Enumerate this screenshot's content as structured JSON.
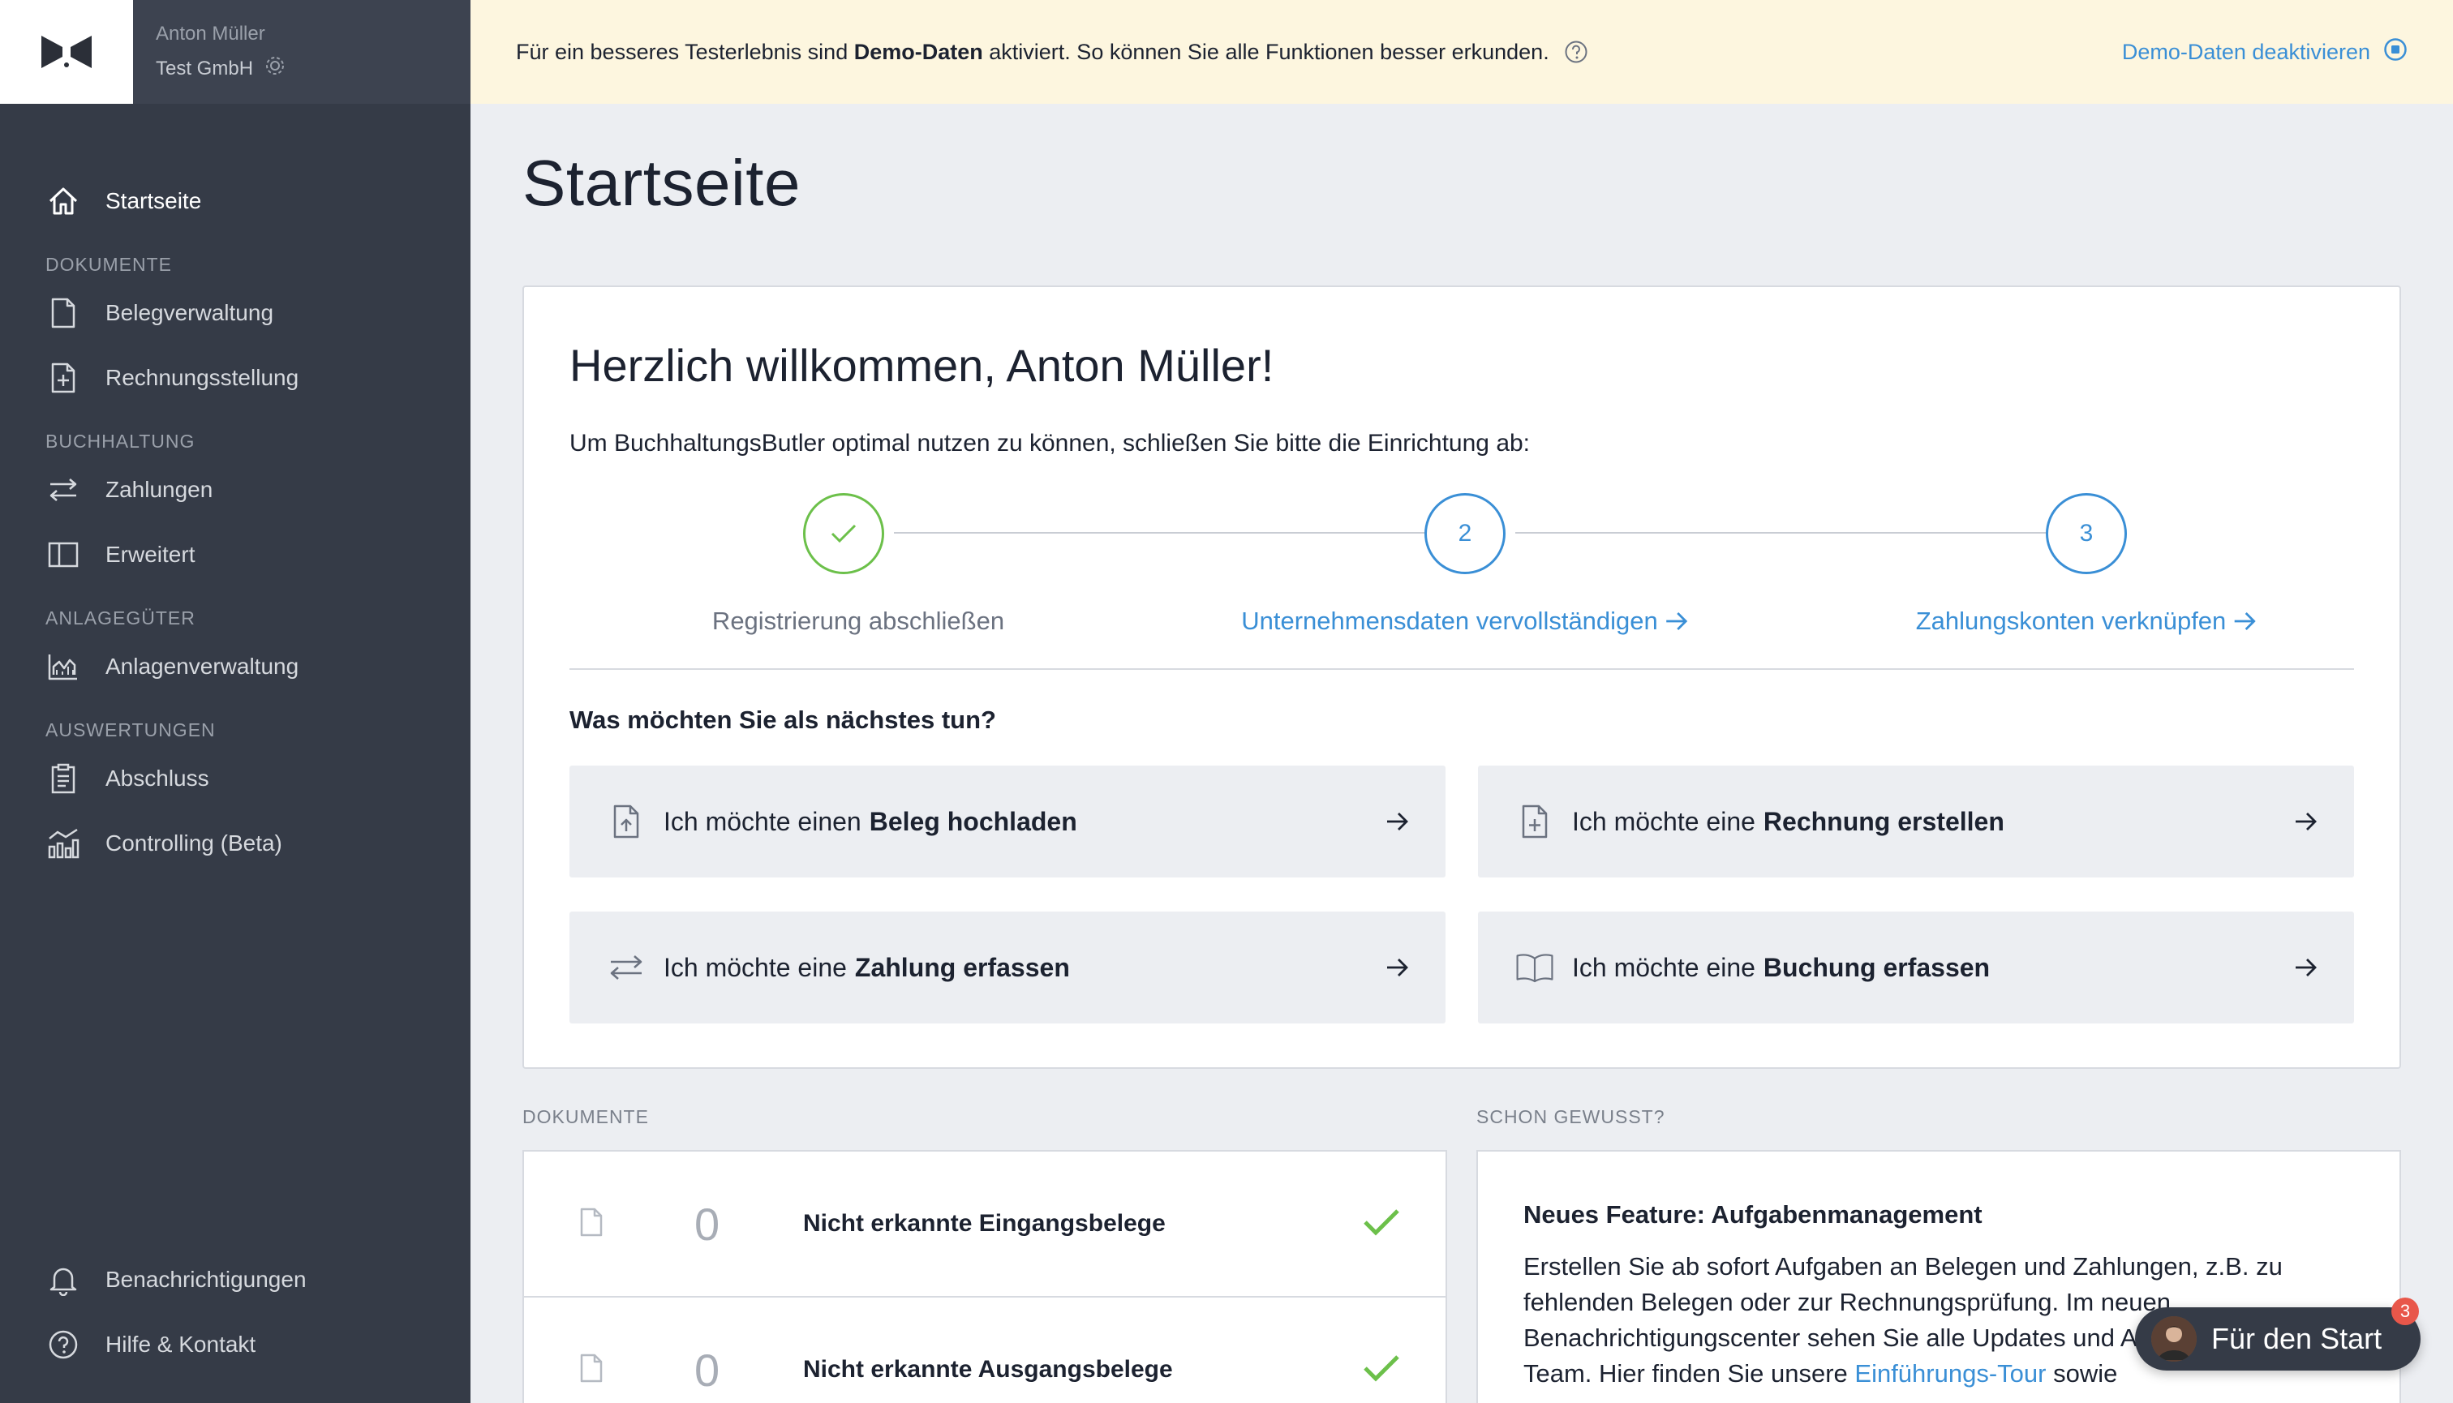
{
  "sidebar": {
    "user_name": "Anton Müller",
    "company": "Test GmbH",
    "nav": {
      "startseite": "Startseite",
      "section_dokumente": "DOKUMENTE",
      "belegverwaltung": "Belegverwaltung",
      "rechnungsstellung": "Rechnungsstellung",
      "section_buchhaltung": "BUCHHALTUNG",
      "zahlungen": "Zahlungen",
      "erweitert": "Erweitert",
      "section_anlagegueter": "ANLAGEGÜTER",
      "anlagenverwaltung": "Anlagenverwaltung",
      "section_auswertungen": "AUSWERTUNGEN",
      "abschluss": "Abschluss",
      "controlling": "Controlling (Beta)",
      "benachrichtigungen": "Benachrichtigungen",
      "hilfe": "Hilfe & Kontakt"
    }
  },
  "banner": {
    "text_before": "Für ein besseres Testerlebnis sind",
    "text_bold": "Demo-Daten",
    "text_after": "aktiviert. So können Sie alle Funktionen besser erkunden.",
    "link": "Demo-Daten deaktivieren"
  },
  "page": {
    "title": "Startseite"
  },
  "welcome": {
    "heading": "Herzlich willkommen, Anton Müller!",
    "intro": "Um BuchhaltungsButler optimal nutzen zu können, schließen Sie bitte die Einrichtung ab:",
    "steps": [
      {
        "number": "",
        "label": "Registrierung abschließen",
        "done": true
      },
      {
        "number": "2",
        "label": "Unternehmensdaten vervollständigen",
        "done": false
      },
      {
        "number": "3",
        "label": "Zahlungskonten verknüpfen",
        "done": false
      }
    ],
    "next_question": "Was möchten Sie als nächstes tun?",
    "actions": [
      {
        "prefix": "Ich möchte einen",
        "bold": "Beleg hochladen"
      },
      {
        "prefix": "Ich möchte eine",
        "bold": "Rechnung erstellen"
      },
      {
        "prefix": "Ich möchte eine",
        "bold": "Zahlung erfassen"
      },
      {
        "prefix": "Ich möchte eine",
        "bold": "Buchung erfassen"
      }
    ]
  },
  "documents": {
    "section_label": "DOKUMENTE",
    "rows": [
      {
        "count": "0",
        "label": "Nicht erkannte Eingangsbelege"
      },
      {
        "count": "0",
        "label": "Nicht erkannte Ausgangsbelege"
      }
    ]
  },
  "tips": {
    "section_label": "SCHON GEWUSST?",
    "title": "Neues Feature: Aufgabenmanagement",
    "text_before": "Erstellen Sie ab sofort Aufgaben an Belegen und Zahlungen, z.B. zu fehlenden Belegen oder zur Rechnungsprüfung. Im neuen Benachrichtigungscenter sehen Sie alle Updates und Aufgaben mit Ihrem Team. Hier finden Sie unsere",
    "link": "Einführungs-Tour",
    "text_after": "sowie"
  },
  "start_button": {
    "label": "Für den Start",
    "badge": "3"
  },
  "colors": {
    "sidebar": "#353b47",
    "accent": "#3a8fd6",
    "success": "#6cc04a",
    "banner": "#fdf6df"
  }
}
